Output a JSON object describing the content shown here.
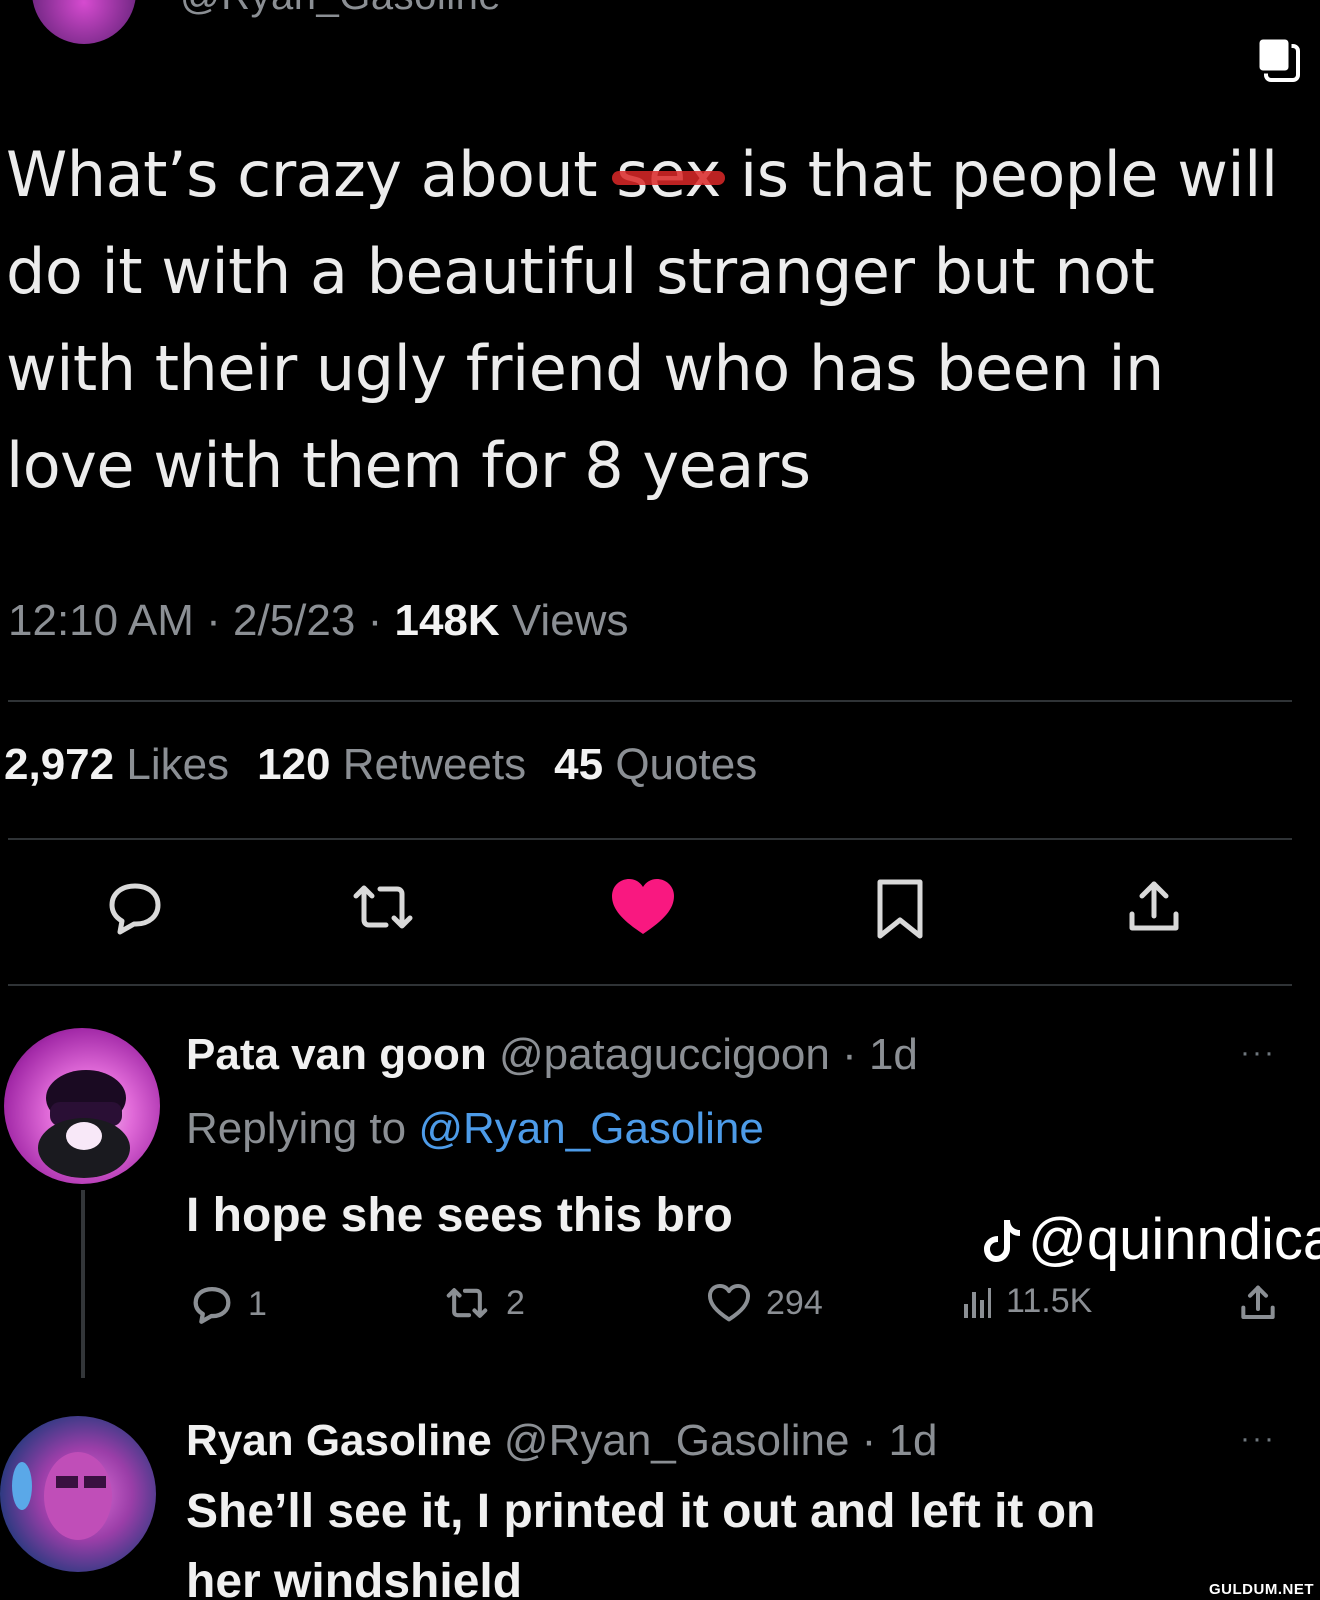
{
  "header": {
    "handle": "@Ryan_Gasoline"
  },
  "tweet": {
    "text_before": "What’s crazy about ",
    "censored_word": "sex",
    "text_after": " is that people will do it with a beautiful stranger but not with their ugly friend who has been in love with them for 8 years",
    "time": "12:10 AM",
    "sep1": " · ",
    "date": "2/5/23",
    "sep2": " · ",
    "views_count": "148K",
    "views_label": " Views",
    "likes_count": "2,972",
    "likes_label": "Likes",
    "retweets_count": "120",
    "retweets_label": "Retweets",
    "quotes_count": "45",
    "quotes_label": "Quotes",
    "like_color": "#f91880"
  },
  "replies": [
    {
      "name": "Pata van goon",
      "handle": "@pataguccigoon",
      "age": " · 1d",
      "replying_prefix": "Replying to ",
      "replying_to": "@Ryan_Gasoline",
      "text": "I hope she sees this bro",
      "reply_count": "1",
      "retweet_count": "2",
      "like_count": "294",
      "view_count": "11.5K"
    },
    {
      "name": "Ryan Gasoline",
      "handle": "@Ryan_Gasoline",
      "age": " · 1d",
      "text_line1": "She’ll see it, I printed it out and left it on",
      "text_line2": "her windshield"
    }
  ],
  "overlay": {
    "tiktok_handle": "@quinndica",
    "site": "GULDUM.NET"
  },
  "icons": [
    "copy-icon",
    "reply-icon",
    "retweet-icon",
    "like-icon",
    "bookmark-icon",
    "share-icon",
    "views-icon",
    "more-icon",
    "tiktok-icon"
  ]
}
